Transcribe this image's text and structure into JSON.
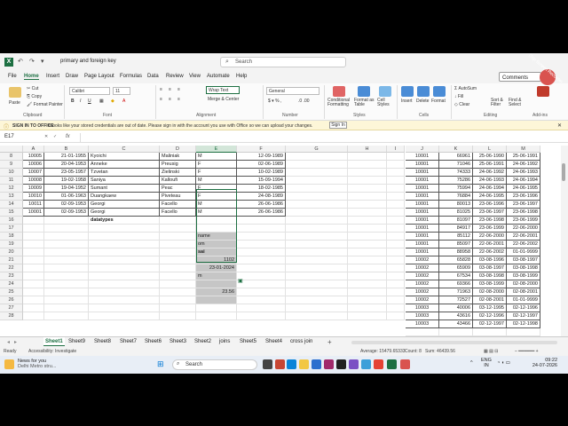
{
  "window": {
    "file_name": "primary and foreign key",
    "search_placeholder": "Search",
    "comments_label": "Comments"
  },
  "menu_tabs": [
    "File",
    "Home",
    "Insert",
    "Draw",
    "Page Layout",
    "Formulas",
    "Data",
    "Review",
    "View",
    "Automate",
    "Help"
  ],
  "ribbon": {
    "paste": "Paste",
    "cut": "Cut",
    "copy": "Copy",
    "format_painter": "Format Painter",
    "font_name": "Calibri",
    "font_size": "11",
    "wrap_text": "Wrap Text",
    "merge_center": "Merge & Center",
    "number_format": "General",
    "conditional_formatting": "Conditional Formatting",
    "format_as_table": "Format as Table",
    "cell_styles": "Cell Styles",
    "insert": "Insert",
    "delete": "Delete",
    "format": "Format",
    "autosum": "AutoSum",
    "fill": "Fill",
    "clear": "Clear",
    "sort_filter": "Sort & Filter",
    "find_select": "Find & Select",
    "groups": {
      "clipboard": "Clipboard",
      "font": "Font",
      "alignment": "Alignment",
      "number": "Number",
      "styles": "Styles",
      "cells": "Cells",
      "editing": "Editing",
      "addins": "Add-ins"
    }
  },
  "infobar": {
    "title": "SIGN IN TO OFFICE",
    "message": "It looks like your stored credentials are out of date. Please sign in with the account you use with Office so we can upload your changes.",
    "button": "Sign In"
  },
  "formula_bar": {
    "name_box": "E17",
    "fx": "fx",
    "value": ""
  },
  "columns_left": [
    "A",
    "B",
    "C",
    "D",
    "E",
    "F",
    "G",
    "H",
    "I"
  ],
  "columns_right": [
    "J",
    "K",
    "L",
    "M"
  ],
  "rows": [
    "8",
    "9",
    "10",
    "11",
    "12",
    "13",
    "14",
    "15",
    "16",
    "17",
    "18",
    "19",
    "20",
    "21",
    "22",
    "23",
    "24",
    "25",
    "26",
    "27",
    "28"
  ],
  "left_table": [
    [
      "10005",
      "21-01-1955",
      "Kyoichi",
      "Maliniak",
      "M",
      "12-09-1989"
    ],
    [
      "10006",
      "20-04-1953",
      "Anneke",
      "Preusig",
      "F",
      "02-06-1989"
    ],
    [
      "10007",
      "23-05-1957",
      "Tzvetan",
      "Zielinski",
      "F",
      "10-02-1989"
    ],
    [
      "10008",
      "19-02-1958",
      "Saniya",
      "Kalloufi",
      "M",
      "15-09-1994"
    ],
    [
      "10009",
      "19-04-1952",
      "Sumant",
      "Peac",
      "F",
      "18-02-1985"
    ],
    [
      "10010",
      "01-06-1963",
      "Duangkaew",
      "Piveteau",
      "F",
      "24-08-1989"
    ],
    [
      "10011",
      "02-09-1953",
      "Georgi",
      "Facello",
      "M",
      "26-06-1986"
    ],
    [
      "10001",
      "02-09-1953",
      "Georgi",
      "Facello",
      "M",
      "26-06-1986"
    ]
  ],
  "datatypes_label": "datatypes",
  "datatype_cells": [
    "",
    "name",
    "om",
    "sai",
    "1102",
    "23-01-2024",
    "m",
    "",
    "23.56",
    ""
  ],
  "right_table": [
    [
      "10001",
      "66961",
      "25-06-1990",
      "25-06-1991"
    ],
    [
      "10001",
      "71046",
      "25-06-1991",
      "24-06-1992"
    ],
    [
      "10001",
      "74333",
      "24-06-1992",
      "24-06-1993"
    ],
    [
      "10001",
      "75286",
      "24-06-1993",
      "24-06-1994"
    ],
    [
      "10001",
      "75994",
      "24-06-1994",
      "24-06-1995"
    ],
    [
      "10001",
      "76884",
      "24-06-1995",
      "23-06-1996"
    ],
    [
      "10001",
      "80013",
      "23-06-1996",
      "23-06-1997"
    ],
    [
      "10001",
      "81025",
      "23-06-1997",
      "23-06-1998"
    ],
    [
      "10001",
      "81097",
      "23-06-1998",
      "23-06-1999"
    ],
    [
      "10001",
      "84917",
      "23-06-1999",
      "22-06-2000"
    ],
    [
      "10001",
      "85112",
      "22-06-2000",
      "22-06-2001"
    ],
    [
      "10001",
      "85097",
      "22-06-2001",
      "22-06-2002"
    ],
    [
      "10001",
      "88958",
      "22-06-2002",
      "01-01-9999"
    ],
    [
      "10002",
      "65828",
      "03-08-1996",
      "03-08-1997"
    ],
    [
      "10002",
      "65909",
      "03-08-1997",
      "03-08-1998"
    ],
    [
      "10002",
      "67534",
      "03-08-1998",
      "03-08-1999"
    ],
    [
      "10002",
      "69366",
      "03-08-1999",
      "02-08-2000"
    ],
    [
      "10002",
      "71963",
      "02-08-2000",
      "02-08-2001"
    ],
    [
      "10002",
      "72527",
      "02-08-2001",
      "01-01-9999"
    ],
    [
      "10003",
      "40006",
      "03-12-1995",
      "02-12-1996"
    ],
    [
      "10003",
      "43616",
      "02-12-1996",
      "02-12-1997"
    ],
    [
      "10003",
      "43466",
      "02-12-1997",
      "02-12-1998"
    ]
  ],
  "sheets": [
    "Sheet1",
    "Sheet9",
    "Sheet8",
    "Sheet7",
    "Sheet6",
    "Sheet3",
    "Sheet2",
    "joins",
    "Sheet5",
    "Sheet4",
    "cross join"
  ],
  "active_sheet": "Sheet1",
  "status": {
    "ready": "Ready",
    "accessibility": "Accessibility: Investigate",
    "average": "Average: 15479.65333",
    "count": "Count: 8",
    "sum": "Sum: 46439.56"
  },
  "taskbar": {
    "news_title": "News for you",
    "news_sub": "Delhi Metro stru...",
    "search": "Search",
    "lang": "ENG",
    "region": "IN",
    "time": "09:22",
    "date": "24-07-2026"
  },
  "watermark": "iTop Screen Recorder",
  "colors": {
    "excel_green": "#1d6f42",
    "selection": "#c6c6c6"
  }
}
